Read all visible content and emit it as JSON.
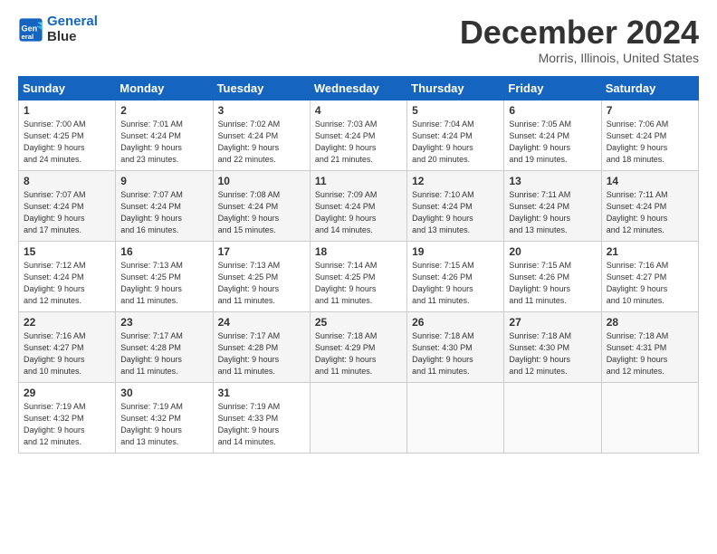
{
  "header": {
    "logo_line1": "General",
    "logo_line2": "Blue",
    "title": "December 2024",
    "location": "Morris, Illinois, United States"
  },
  "days_of_week": [
    "Sunday",
    "Monday",
    "Tuesday",
    "Wednesday",
    "Thursday",
    "Friday",
    "Saturday"
  ],
  "weeks": [
    [
      {
        "day": "1",
        "info": "Sunrise: 7:00 AM\nSunset: 4:25 PM\nDaylight: 9 hours\nand 24 minutes."
      },
      {
        "day": "2",
        "info": "Sunrise: 7:01 AM\nSunset: 4:24 PM\nDaylight: 9 hours\nand 23 minutes."
      },
      {
        "day": "3",
        "info": "Sunrise: 7:02 AM\nSunset: 4:24 PM\nDaylight: 9 hours\nand 22 minutes."
      },
      {
        "day": "4",
        "info": "Sunrise: 7:03 AM\nSunset: 4:24 PM\nDaylight: 9 hours\nand 21 minutes."
      },
      {
        "day": "5",
        "info": "Sunrise: 7:04 AM\nSunset: 4:24 PM\nDaylight: 9 hours\nand 20 minutes."
      },
      {
        "day": "6",
        "info": "Sunrise: 7:05 AM\nSunset: 4:24 PM\nDaylight: 9 hours\nand 19 minutes."
      },
      {
        "day": "7",
        "info": "Sunrise: 7:06 AM\nSunset: 4:24 PM\nDaylight: 9 hours\nand 18 minutes."
      }
    ],
    [
      {
        "day": "8",
        "info": "Sunrise: 7:07 AM\nSunset: 4:24 PM\nDaylight: 9 hours\nand 17 minutes."
      },
      {
        "day": "9",
        "info": "Sunrise: 7:07 AM\nSunset: 4:24 PM\nDaylight: 9 hours\nand 16 minutes."
      },
      {
        "day": "10",
        "info": "Sunrise: 7:08 AM\nSunset: 4:24 PM\nDaylight: 9 hours\nand 15 minutes."
      },
      {
        "day": "11",
        "info": "Sunrise: 7:09 AM\nSunset: 4:24 PM\nDaylight: 9 hours\nand 14 minutes."
      },
      {
        "day": "12",
        "info": "Sunrise: 7:10 AM\nSunset: 4:24 PM\nDaylight: 9 hours\nand 13 minutes."
      },
      {
        "day": "13",
        "info": "Sunrise: 7:11 AM\nSunset: 4:24 PM\nDaylight: 9 hours\nand 13 minutes."
      },
      {
        "day": "14",
        "info": "Sunrise: 7:11 AM\nSunset: 4:24 PM\nDaylight: 9 hours\nand 12 minutes."
      }
    ],
    [
      {
        "day": "15",
        "info": "Sunrise: 7:12 AM\nSunset: 4:24 PM\nDaylight: 9 hours\nand 12 minutes."
      },
      {
        "day": "16",
        "info": "Sunrise: 7:13 AM\nSunset: 4:25 PM\nDaylight: 9 hours\nand 11 minutes."
      },
      {
        "day": "17",
        "info": "Sunrise: 7:13 AM\nSunset: 4:25 PM\nDaylight: 9 hours\nand 11 minutes."
      },
      {
        "day": "18",
        "info": "Sunrise: 7:14 AM\nSunset: 4:25 PM\nDaylight: 9 hours\nand 11 minutes."
      },
      {
        "day": "19",
        "info": "Sunrise: 7:15 AM\nSunset: 4:26 PM\nDaylight: 9 hours\nand 11 minutes."
      },
      {
        "day": "20",
        "info": "Sunrise: 7:15 AM\nSunset: 4:26 PM\nDaylight: 9 hours\nand 11 minutes."
      },
      {
        "day": "21",
        "info": "Sunrise: 7:16 AM\nSunset: 4:27 PM\nDaylight: 9 hours\nand 10 minutes."
      }
    ],
    [
      {
        "day": "22",
        "info": "Sunrise: 7:16 AM\nSunset: 4:27 PM\nDaylight: 9 hours\nand 10 minutes."
      },
      {
        "day": "23",
        "info": "Sunrise: 7:17 AM\nSunset: 4:28 PM\nDaylight: 9 hours\nand 11 minutes."
      },
      {
        "day": "24",
        "info": "Sunrise: 7:17 AM\nSunset: 4:28 PM\nDaylight: 9 hours\nand 11 minutes."
      },
      {
        "day": "25",
        "info": "Sunrise: 7:18 AM\nSunset: 4:29 PM\nDaylight: 9 hours\nand 11 minutes."
      },
      {
        "day": "26",
        "info": "Sunrise: 7:18 AM\nSunset: 4:30 PM\nDaylight: 9 hours\nand 11 minutes."
      },
      {
        "day": "27",
        "info": "Sunrise: 7:18 AM\nSunset: 4:30 PM\nDaylight: 9 hours\nand 12 minutes."
      },
      {
        "day": "28",
        "info": "Sunrise: 7:18 AM\nSunset: 4:31 PM\nDaylight: 9 hours\nand 12 minutes."
      }
    ],
    [
      {
        "day": "29",
        "info": "Sunrise: 7:19 AM\nSunset: 4:32 PM\nDaylight: 9 hours\nand 12 minutes."
      },
      {
        "day": "30",
        "info": "Sunrise: 7:19 AM\nSunset: 4:32 PM\nDaylight: 9 hours\nand 13 minutes."
      },
      {
        "day": "31",
        "info": "Sunrise: 7:19 AM\nSunset: 4:33 PM\nDaylight: 9 hours\nand 14 minutes."
      },
      {
        "day": "",
        "info": ""
      },
      {
        "day": "",
        "info": ""
      },
      {
        "day": "",
        "info": ""
      },
      {
        "day": "",
        "info": ""
      }
    ]
  ]
}
